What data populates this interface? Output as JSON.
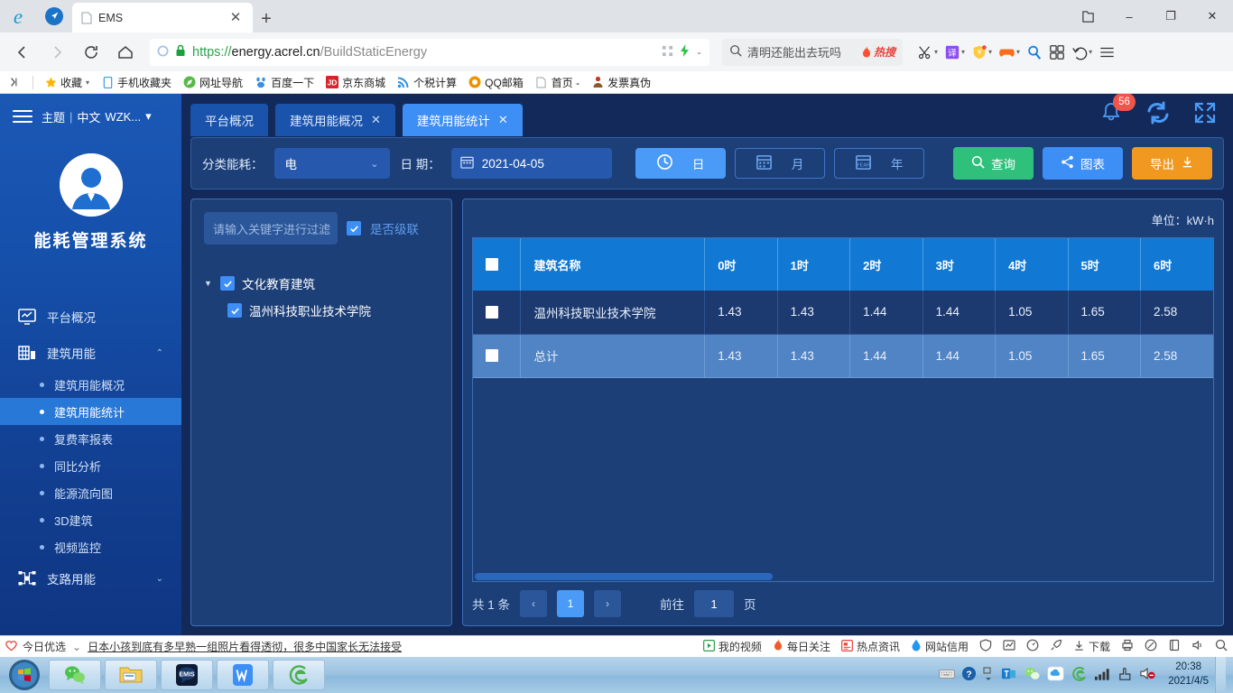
{
  "browser": {
    "tab": {
      "title": "EMS",
      "close_label": "✕",
      "favicon": "page-icon"
    },
    "new_tab_label": "+",
    "window_controls": {
      "collections": "collections-icon",
      "minimize": "–",
      "maximize": "❐",
      "close": "✕"
    },
    "address": {
      "scheme": "https://",
      "domain": "energy.acrel.cn",
      "path": "/BuildStaticEnergy",
      "lock": "lock-icon"
    },
    "search": {
      "query": "清明还能出去玩吗",
      "hot_label": "热搜"
    },
    "bookmarks": [
      {
        "label": "收藏",
        "icon": "star-icon",
        "caret": "▾"
      },
      {
        "label": "手机收藏夹",
        "icon": "phone-icon"
      },
      {
        "label": "网址导航",
        "icon": "compass-icon"
      },
      {
        "label": "百度一下",
        "icon": "baidu-icon"
      },
      {
        "label": "京东商城",
        "icon": "jd-icon"
      },
      {
        "label": "个税计算",
        "icon": "rss-icon"
      },
      {
        "label": "QQ邮箱",
        "icon": "qqmail-icon"
      },
      {
        "label": "首页 -",
        "icon": "page-icon"
      },
      {
        "label": "发票真伪",
        "icon": "invoice-icon"
      }
    ],
    "toolbar_icons": [
      "scissors-icon",
      "translate-icon",
      "shield-icon",
      "game-icon",
      "magnifier-icon",
      "apps-grid-icon",
      "undo-icon",
      "menu-icon"
    ]
  },
  "sidebar": {
    "theme_label": "主题",
    "lang_label": "中文",
    "user_label": "WZK...",
    "user_caret": "▾",
    "system_title": "能耗管理系统",
    "menu": [
      {
        "label": "平台概况",
        "icon": "monitor-icon",
        "expandable": false
      },
      {
        "label": "建筑用能",
        "icon": "building-icon",
        "expandable": true,
        "chevron": "⌃"
      }
    ],
    "submenu": [
      {
        "label": "建筑用能概况",
        "active": false
      },
      {
        "label": "建筑用能统计",
        "active": true
      },
      {
        "label": "复费率报表",
        "active": false
      },
      {
        "label": "同比分析",
        "active": false
      },
      {
        "label": "能源流向图",
        "active": false
      },
      {
        "label": "3D建筑",
        "active": false
      },
      {
        "label": "视频监控",
        "active": false
      }
    ],
    "menu_bottom": {
      "label": "支路用能",
      "icon": "branch-icon",
      "chevron": "⌄"
    }
  },
  "header": {
    "tabs": [
      {
        "label": "平台概况",
        "closable": false,
        "active": false
      },
      {
        "label": "建筑用能概况",
        "closable": true,
        "active": false,
        "close": "✕"
      },
      {
        "label": "建筑用能统计",
        "closable": true,
        "active": true,
        "close": "✕"
      }
    ],
    "notification_count": "56",
    "icons": [
      "bell-icon",
      "refresh-icon",
      "fullscreen-icon"
    ]
  },
  "filter": {
    "category_label": "分类能耗：",
    "category_value": "电",
    "category_caret": "⌄",
    "date_label": "日 期：",
    "date_value": "2021-04-05",
    "periods": [
      {
        "label": "日",
        "icon": "clock-icon",
        "active": true
      },
      {
        "label": "月",
        "icon": "calendar-month-icon",
        "active": false
      },
      {
        "label": "年",
        "icon": "calendar-year-icon",
        "active": false
      }
    ],
    "buttons": [
      {
        "label": "查询",
        "icon": "search-icon",
        "color": "#2fc17c"
      },
      {
        "label": "图表",
        "icon": "share-icon",
        "color": "#3d8ef5"
      },
      {
        "label": "导出",
        "icon": "download-icon",
        "color": "#f0981f"
      }
    ]
  },
  "tree": {
    "search_placeholder": "请输入关键字进行过滤",
    "cascade_label": "是否级联",
    "cascade_checked": true,
    "nodes": [
      {
        "label": "文化教育建筑",
        "level": 0,
        "checked": true,
        "expanded": true,
        "triangle": "▼"
      },
      {
        "label": "温州科技职业技术学院",
        "level": 1,
        "checked": true
      }
    ]
  },
  "table": {
    "unit_label": "单位：",
    "unit_value": "kW·h",
    "columns": [
      "建筑名称",
      "0时",
      "1时",
      "2时",
      "3时",
      "4时",
      "5时",
      "6时"
    ],
    "rows": [
      {
        "name": "温州科技职业技术学院",
        "values": [
          "1.43",
          "1.43",
          "1.44",
          "1.44",
          "1.05",
          "1.65",
          "2.58"
        ],
        "total": false
      },
      {
        "name": "总计",
        "values": [
          "1.43",
          "1.43",
          "1.44",
          "1.44",
          "1.05",
          "1.65",
          "2.58"
        ],
        "total": true
      }
    ]
  },
  "pager": {
    "total_label": "共 1 条",
    "prev": "‹",
    "pages": [
      "1"
    ],
    "next": "›",
    "goto_label": "前往",
    "goto_value": "1",
    "page_unit": "页"
  },
  "newsbar": {
    "brand": "今日优选",
    "expand": "⌄",
    "headline": "日本小孩到底有多早熟一组照片看得透彻，很多中国家长无法接受",
    "right_items": [
      {
        "label": "我的视频",
        "icon": "video-icon"
      },
      {
        "label": "每日关注",
        "icon": "flame-icon"
      },
      {
        "label": "热点资讯",
        "icon": "news-icon"
      },
      {
        "label": "网站信用",
        "icon": "drop-icon"
      },
      {
        "label": "",
        "icon": "shield-icon"
      },
      {
        "label": "",
        "icon": "chart-icon"
      },
      {
        "label": "",
        "icon": "speed-icon"
      },
      {
        "label": "",
        "icon": "rocket-icon"
      },
      {
        "label": "下载",
        "icon": "download-icon"
      },
      {
        "label": "",
        "icon": "print-icon"
      },
      {
        "label": "",
        "icon": "cookie-icon"
      },
      {
        "label": "",
        "icon": "window-icon"
      },
      {
        "label": "",
        "icon": "sound-icon"
      },
      {
        "label": "",
        "icon": "search-icon"
      }
    ]
  },
  "taskbar": {
    "start_label": "start-orb",
    "apps": [
      "wechat-icon",
      "explorer-icon",
      "ems-icon",
      "wps-icon",
      "browser-icon"
    ],
    "tray_icons": [
      "keyboard-icon",
      "help-icon",
      "expand-icon",
      "teams-icon",
      "wechat-tray-icon",
      "cloud-icon",
      "browser-tray-icon",
      "signal-icon",
      "security-icon",
      "volume-muted-icon"
    ],
    "time": "20:38",
    "date": "2021/4/5"
  }
}
